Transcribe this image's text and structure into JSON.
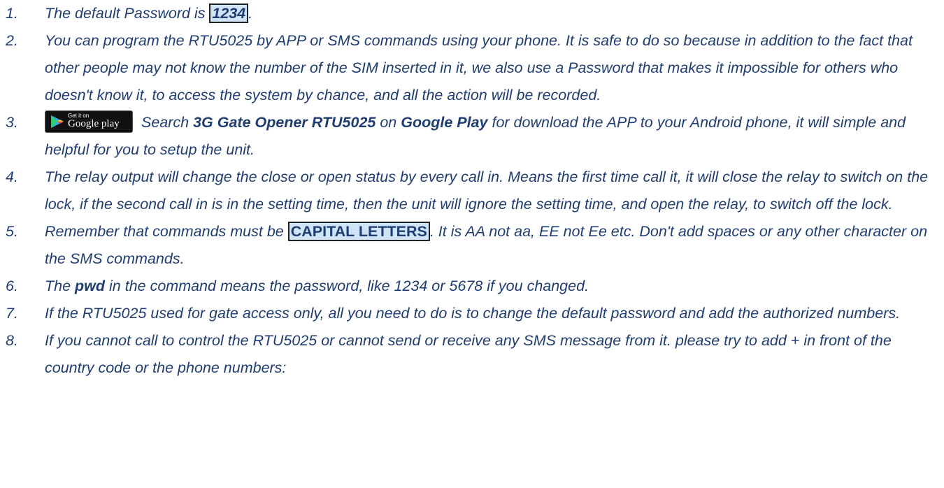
{
  "items": [
    {
      "num": "1.",
      "pre": "The default Password is ",
      "highlight": "1234",
      "post": "."
    },
    {
      "num": "2.",
      "text": "You can program the RTU5025 by APP or SMS commands using your phone. It is safe to do so because in addition to the fact that other people may not know the number of the SIM inserted in it, we also use a Password that makes it impossible for others who doesn't know it, to access the system by chance, and all the action will be recorded."
    },
    {
      "num": "3.",
      "badge": {
        "small": "Get it on",
        "big": "Google play",
        "icon": "play-triangle-icon"
      },
      "t1": " Search ",
      "b1": "3G Gate Opener RTU5025",
      "t2": " on ",
      "b2": "Google Play",
      "t3": " for download the APP to your Android phone, it will simple and helpful for you to setup the unit."
    },
    {
      "num": "4.",
      "text": "The relay output will change the close or open status by every call in. Means the first time call it, it will close the relay to switch on the lock, if the second call in is in the setting time, then the unit will ignore the setting time, and open the relay, to switch off the lock."
    },
    {
      "num": "5.",
      "pre": "Remember that commands must be ",
      "highlight": "CAPITAL LETTERS",
      "post": ". It is AA not aa, EE not Ee etc. Don't add spaces or any other character on the SMS commands."
    },
    {
      "num": "6.",
      "pre": "The ",
      "bold": "pwd",
      "post": " in the command means the password, like 1234 or 5678 if you changed."
    },
    {
      "num": "7.",
      "text": "If the RTU5025 used for gate access only, all you need to do is to change the default password and add the authorized numbers."
    },
    {
      "num": "8.",
      "text": "If you cannot call to control the RTU5025 or cannot send or receive any SMS message from it. please try to add + in front of the country code or the phone numbers:"
    }
  ],
  "colors": {
    "text": "#1f3c73",
    "highlight_bg": "#cfe4f7",
    "badge_bg": "#111111"
  }
}
